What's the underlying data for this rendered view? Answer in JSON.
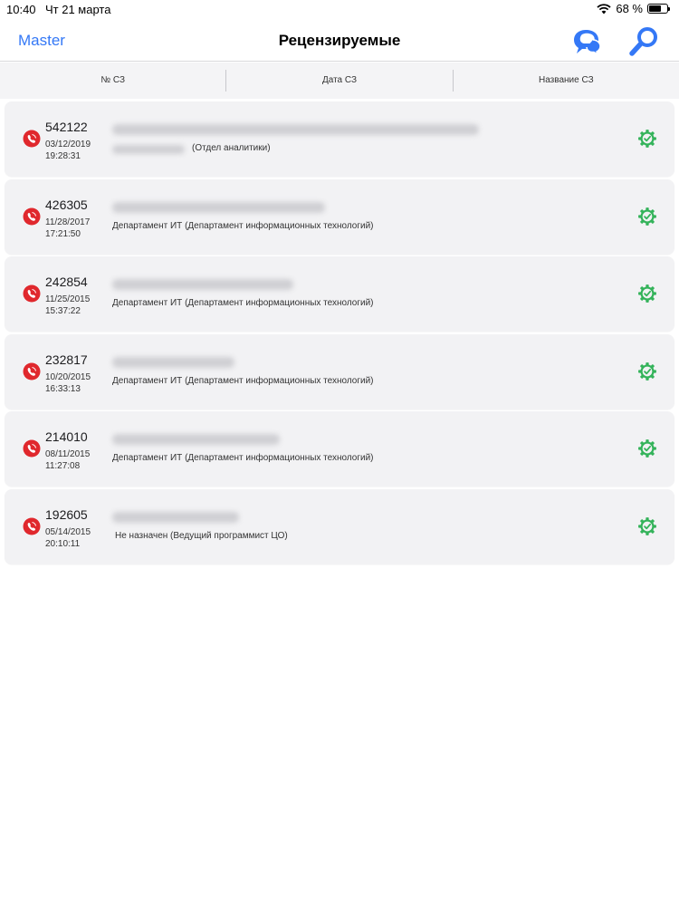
{
  "status_bar": {
    "time": "10:40",
    "date": "Чт 21 марта",
    "battery": "68 %",
    "battery_level": 0.68
  },
  "nav": {
    "back_label": "Master",
    "title": "Рецензируемые"
  },
  "columns": [
    "№ СЗ",
    "Дата СЗ",
    "Название СЗ"
  ],
  "colors": {
    "accent": "#3478f6",
    "priority": "#e0282d",
    "status_ok": "#34b35a"
  },
  "rows": [
    {
      "number": "542122",
      "date": "03/12/2019",
      "time": "19:28:31",
      "department": "(Отдел аналитики)"
    },
    {
      "number": "426305",
      "date": "11/28/2017",
      "time": "17:21:50",
      "department": "Департамент ИТ (Департамент информационных технологий)"
    },
    {
      "number": "242854",
      "date": "11/25/2015",
      "time": "15:37:22",
      "department": "Департамент ИТ (Департамент информационных технологий)"
    },
    {
      "number": "232817",
      "date": "10/20/2015",
      "time": "16:33:13",
      "department": "Департамент ИТ (Департамент информационных технологий)"
    },
    {
      "number": "214010",
      "date": "08/11/2015",
      "time": "11:27:08",
      "department": "Департамент ИТ (Департамент информационных технологий)"
    },
    {
      "number": "192605",
      "date": "05/14/2015",
      "time": "20:10:11",
      "department": "Не назначен  (Ведущий программист ЦО)"
    }
  ]
}
